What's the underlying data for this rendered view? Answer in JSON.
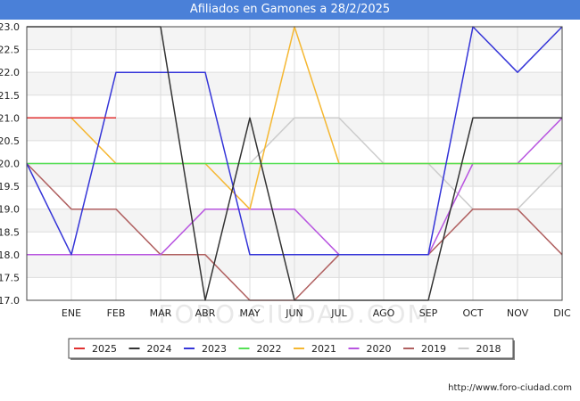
{
  "header": {
    "title": "Afiliados en Gamones a 28/2/2025"
  },
  "footer": {
    "url": "http://www.foro-ciudad.com"
  },
  "chart_data": {
    "type": "line",
    "title": "Afiliados en Gamones a 28/2/2025",
    "watermark": "FORO-CIUDAD.COM",
    "categories": [
      "ENE",
      "FEB",
      "MAR",
      "ABR",
      "MAY",
      "JUN",
      "JUL",
      "AGO",
      "SEP",
      "OCT",
      "NOV",
      "DIC"
    ],
    "ylim": [
      17.0,
      23.0
    ],
    "yticks": [
      "17.0",
      "17.5",
      "18.0",
      "18.5",
      "19.0",
      "19.5",
      "20.0",
      "20.5",
      "21.0",
      "21.5",
      "22.0",
      "22.5",
      "23.0"
    ],
    "grid": true,
    "legend_position": "bottom",
    "series": [
      {
        "name": "2018",
        "color": "#cccccc",
        "values": [
          20,
          20,
          20,
          20,
          20,
          21,
          21,
          20,
          20,
          19,
          19,
          20
        ]
      },
      {
        "name": "2019",
        "color": "#b06060",
        "values": [
          19,
          19,
          18,
          18,
          17,
          17,
          18,
          18,
          18,
          19,
          19,
          18
        ]
      },
      {
        "name": "2020",
        "color": "#b855e0",
        "values": [
          18,
          18,
          18,
          19,
          19,
          19,
          18,
          18,
          18,
          20,
          20,
          21
        ]
      },
      {
        "name": "2021",
        "color": "#f5b731",
        "values": [
          21,
          20,
          20,
          20,
          19,
          23,
          20,
          20,
          20,
          20,
          20,
          20
        ]
      },
      {
        "name": "2022",
        "color": "#55e055",
        "values": [
          20,
          20,
          20,
          20,
          20,
          20,
          20,
          20,
          20,
          20,
          20,
          20
        ]
      },
      {
        "name": "2023",
        "color": "#3535d8",
        "values": [
          18,
          22,
          22,
          22,
          18,
          18,
          18,
          18,
          18,
          23,
          22,
          23
        ]
      },
      {
        "name": "2024",
        "color": "#333333",
        "values": [
          23,
          23,
          23,
          17,
          21,
          17,
          17,
          17,
          17,
          21,
          21,
          21
        ]
      },
      {
        "name": "2025",
        "color": "#e03030",
        "values": [
          21,
          21
        ]
      }
    ],
    "start_values": {
      "2018": 20,
      "2019": 20,
      "2020": 18,
      "2021": 21,
      "2022": 20,
      "2023": 20,
      "2024": 23,
      "2025": 21
    }
  },
  "legend_order": [
    "2025",
    "2024",
    "2023",
    "2022",
    "2021",
    "2020",
    "2019",
    "2018"
  ]
}
